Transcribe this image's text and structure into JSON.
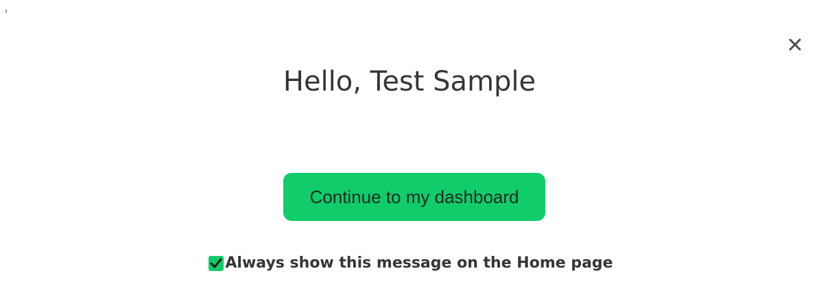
{
  "dialog": {
    "title": "Hello, Test Sample",
    "close_icon": "close-icon",
    "continue_label": "Continue to my dashboard",
    "always_show": {
      "label": "Always show this message on the Home page",
      "checked": true,
      "icon": "checkmark-icon"
    }
  },
  "colors": {
    "accent": "#10cc6a",
    "text": "#32363a",
    "background": "#ffffff"
  }
}
